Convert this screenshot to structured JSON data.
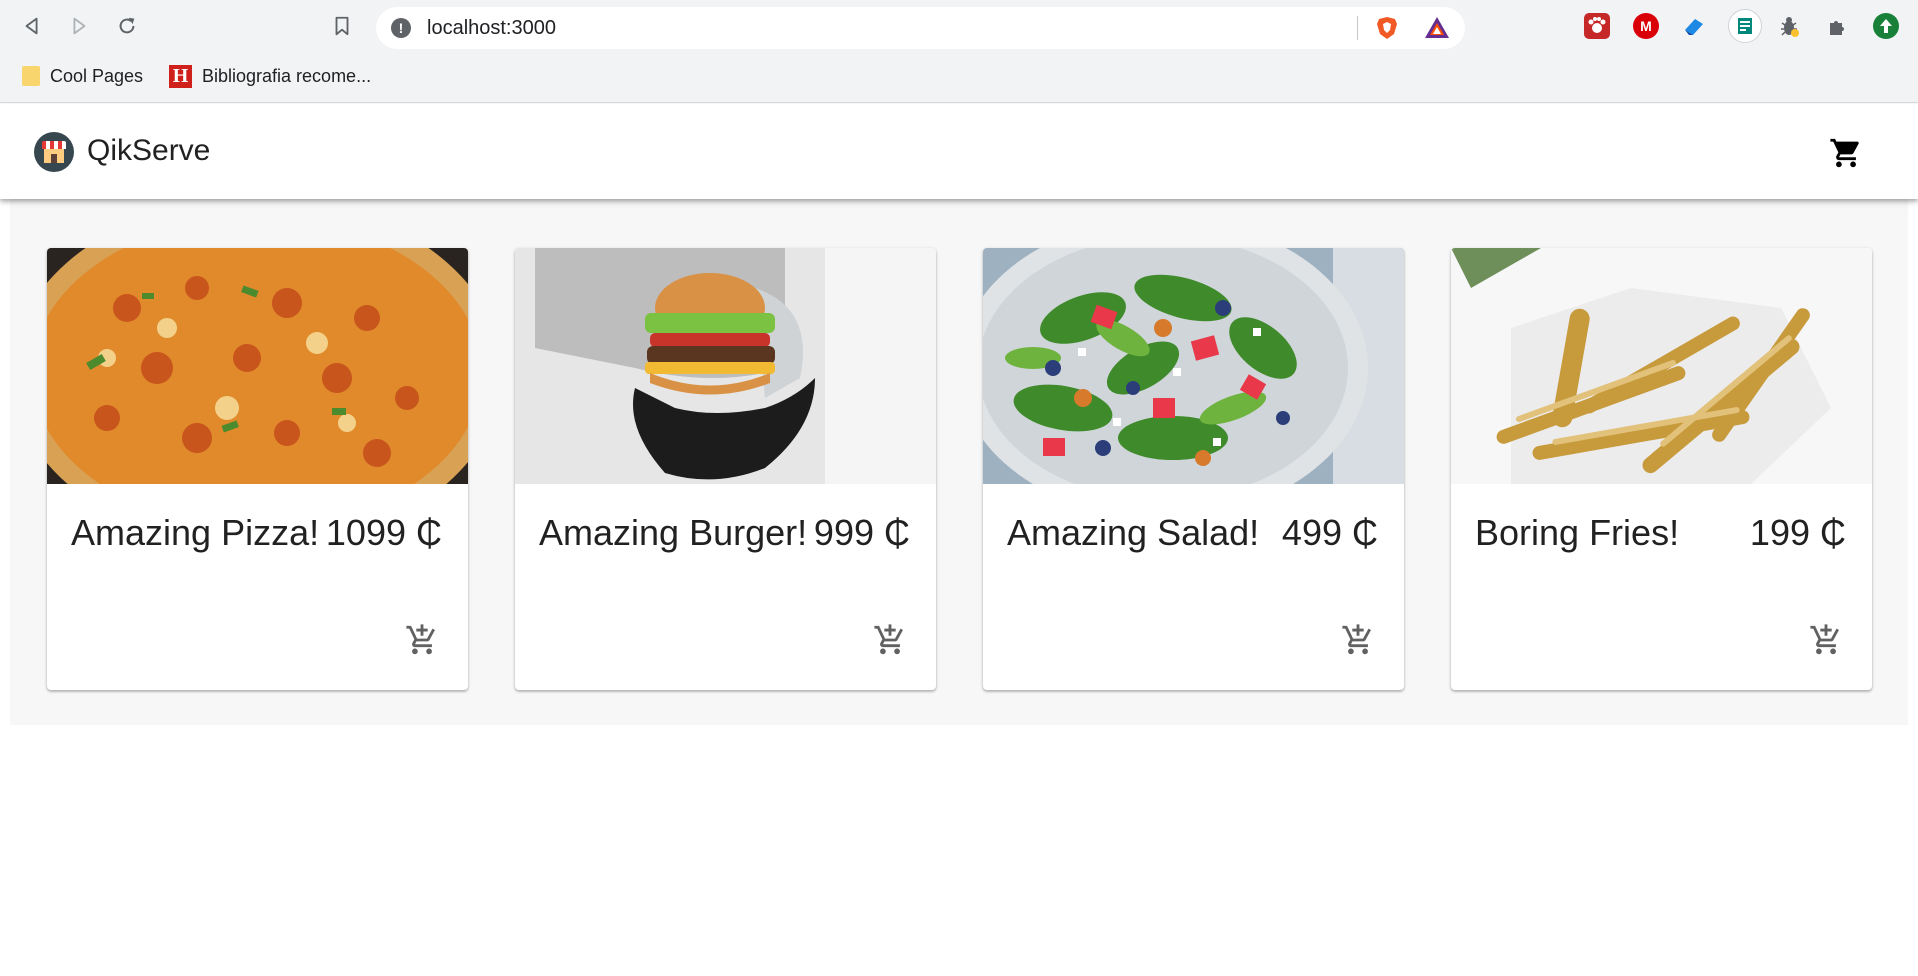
{
  "browser": {
    "url": "localhost:3000",
    "bookmarks": [
      {
        "label": "Cool Pages",
        "icon": "folder-icon"
      },
      {
        "label": "Bibliografia recome...",
        "icon": "h-logo-icon"
      }
    ],
    "extensions": [
      "paw-extension-icon",
      "mega-extension-icon",
      "eraser-extension-icon",
      "sheet-extension-icon",
      "bug-extension-icon",
      "puzzle-extensions-icon",
      "update-icon"
    ]
  },
  "app": {
    "title": "QikServe",
    "accent": "#212121"
  },
  "products": [
    {
      "name": "Amazing Pizza!",
      "price": "1099 ₵",
      "image": "pizza"
    },
    {
      "name": "Amazing Burger!",
      "price": "999 ₵",
      "image": "burger"
    },
    {
      "name": "Amazing Salad!",
      "price": "499 ₵",
      "image": "salad"
    },
    {
      "name": "Boring Fries!",
      "price": "199 ₵",
      "image": "fries"
    }
  ]
}
